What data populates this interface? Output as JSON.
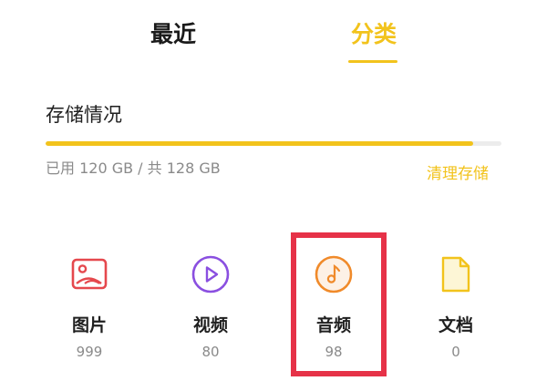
{
  "tabs": [
    {
      "label": "最近"
    },
    {
      "label": "分类"
    }
  ],
  "storage": {
    "title": "存储情况",
    "usage_text": "已用 120 GB / 共 128 GB",
    "used_fraction": 0.9375,
    "clean_label": "清理存储"
  },
  "categories": [
    {
      "label": "图片",
      "count": "999",
      "icon": "image-icon",
      "color": "#e5484d"
    },
    {
      "label": "视频",
      "count": "80",
      "icon": "play-icon",
      "color": "#8a4fe0"
    },
    {
      "label": "音频",
      "count": "98",
      "icon": "music-note-icon",
      "color": "#f08a2a"
    },
    {
      "label": "文档",
      "count": "0",
      "icon": "document-icon",
      "color": "#f2c31c"
    }
  ],
  "colors": {
    "accent": "#f2c31c",
    "highlight": "#e63248"
  }
}
